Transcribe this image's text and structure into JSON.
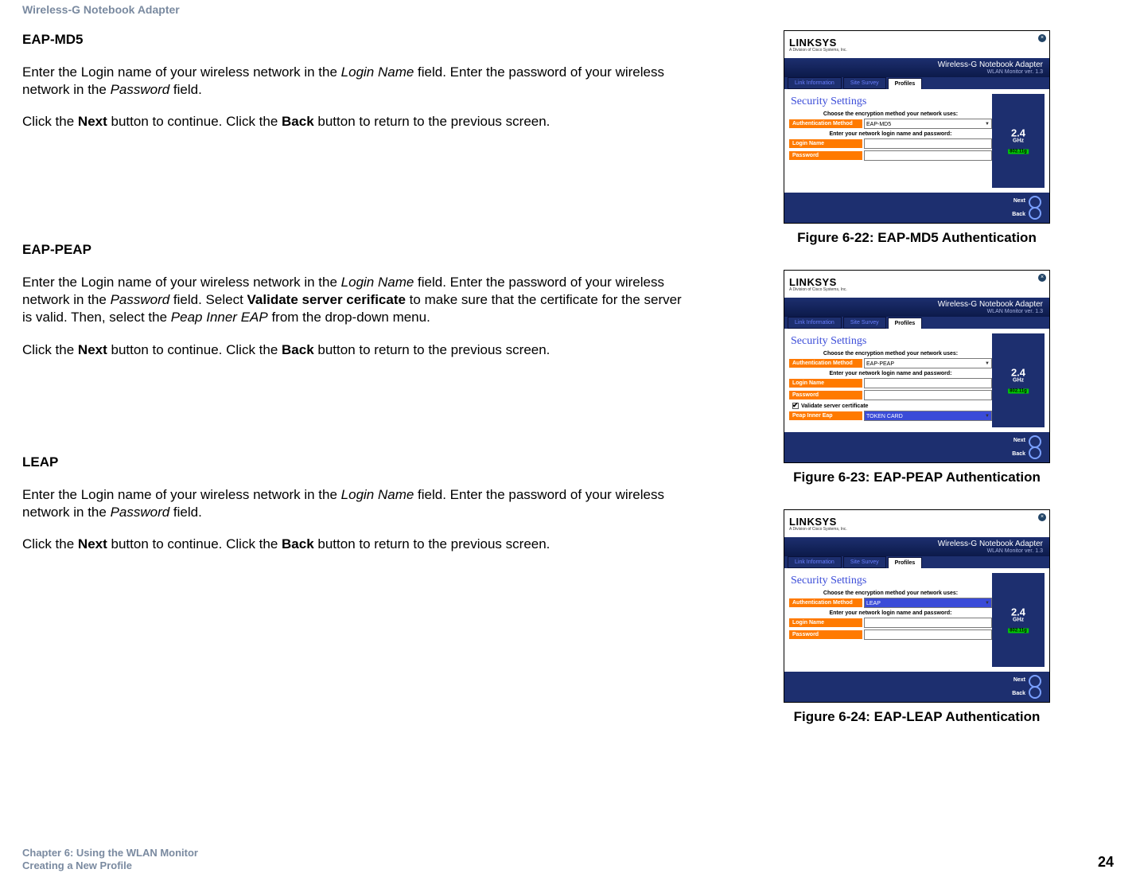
{
  "header": {
    "title": "Wireless-G Notebook Adapter"
  },
  "footer": {
    "left_line1": "Chapter 6: Using the WLAN Monitor",
    "left_line2": "Creating a New Profile",
    "page": "24"
  },
  "sections": {
    "md5": {
      "heading": "EAP-MD5",
      "p1a": "Enter the Login name of your wireless network in the ",
      "p1_login": "Login Name",
      "p1b": " field. Enter the password of your wireless network in the ",
      "p1_pw": "Password",
      "p1c": " field.",
      "p2a": "Click the ",
      "p2_next": "Next",
      "p2b": " button to continue. Click the ",
      "p2_back": "Back",
      "p2c": " button to return to the previous screen."
    },
    "peap": {
      "heading": "EAP-PEAP",
      "p1a": "Enter the Login name of your wireless network in the ",
      "p1_login": "Login Name",
      "p1b": " field. Enter the password of your wireless network in the ",
      "p1_pw": "Password",
      "p1c": " field. Select ",
      "p1_val": "Validate server cerificate",
      "p1d": " to make sure that the certificate for the server is valid. Then, select the ",
      "p1_inner": "Peap Inner EAP",
      "p1e": " from the drop-down menu.",
      "p2a": "Click the ",
      "p2_next": "Next",
      "p2b": " button to continue. Click the ",
      "p2_back": "Back",
      "p2c": " button to return to the previous screen."
    },
    "leap": {
      "heading": "LEAP",
      "p1a": "Enter the Login name of your wireless network in the ",
      "p1_login": "Login Name",
      "p1b": " field. Enter the password of your wireless network in the ",
      "p1_pw": "Password",
      "p1c": " field.",
      "p2a": "Click the ",
      "p2_next": "Next",
      "p2b": " button to continue. Click the ",
      "p2_back": "Back",
      "p2c": " button to return to the previous screen."
    }
  },
  "figures": {
    "f22": {
      "caption": "Figure 6-22: EAP-MD5 Authentication"
    },
    "f23": {
      "caption": "Figure 6-23: EAP-PEAP Authentication"
    },
    "f24": {
      "caption": "Figure 6-24: EAP-LEAP Authentication"
    }
  },
  "shot": {
    "logo": "LINKSYS",
    "logo_sub": "A Division of Cisco Systems, Inc.",
    "banner_line1": "Wireless-G Notebook Adapter",
    "banner_line2": "WLAN Monitor  ver. 1.3",
    "tabs": {
      "link": "Link Information",
      "site": "Site Survey",
      "profiles": "Profiles"
    },
    "sec_title": "Security Settings",
    "choose_lbl": "Choose the encryption method your network uses:",
    "auth_lbl": "Authentication Method",
    "enter_lbl": "Enter your network login name and password:",
    "login_lbl": "Login Name",
    "pw_lbl": "Password",
    "validate_lbl": "Validate server certificate",
    "peap_inner_lbl": "Peap Inner Eap",
    "peap_inner_val": "TOKEN CARD",
    "auth_md5": "EAP-MD5",
    "auth_peap": "EAP-PEAP",
    "auth_leap": "LEAP",
    "ghz_main": "2.4",
    "ghz_sub": "GHz",
    "ghz_badge": "802.11g",
    "next": "Next",
    "back": "Back"
  }
}
